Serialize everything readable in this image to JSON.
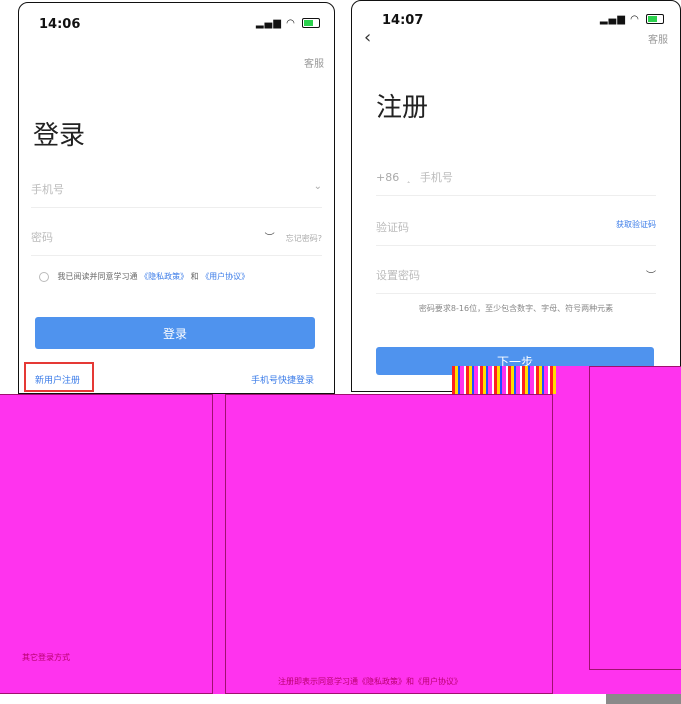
{
  "login": {
    "time": "14:06",
    "customer_service": "客服",
    "title": "登录",
    "phone_placeholder": "手机号",
    "password_placeholder": "密码",
    "forgot_password": "忘记密码?",
    "agreement_prefix": "我已阅读并同意学习通",
    "privacy_policy": "《隐私政策》",
    "agreement_and": "和",
    "user_agreement": "《用户协议》",
    "login_button": "登录",
    "new_user_register": "新用户注册",
    "phone_quick_login": "手机号快捷登录",
    "other_login": "其它登录方式"
  },
  "register": {
    "time": "14:07",
    "customer_service": "客服",
    "title": "注册",
    "country_code": "+86",
    "phone_placeholder": "手机号",
    "code_placeholder": "验证码",
    "get_code": "获取验证码",
    "password_placeholder": "设置密码",
    "password_hint": "密码要求8-16位，至少包含数字、字母、符号两种元素",
    "next_button": "下一步",
    "footer_agreement": "注册即表示同意学习通《隐私政策》和《用户协议》"
  },
  "colors": {
    "accent": "#4f93ee",
    "link": "#3a7be8",
    "highlight_box": "#e53935",
    "corruption": "#ff33ee"
  }
}
